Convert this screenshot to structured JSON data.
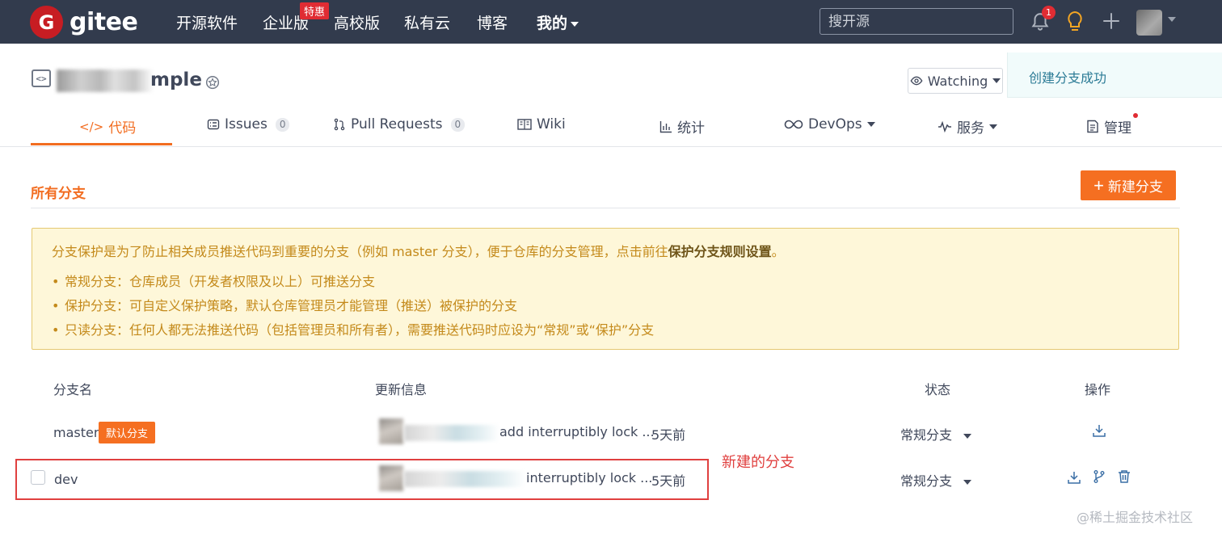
{
  "topnav": {
    "logo_letter": "G",
    "logo_text": "gitee",
    "items": [
      "开源软件",
      "企业版",
      "高校版",
      "私有云",
      "博客",
      "我的"
    ],
    "new_badge": "特惠",
    "search_placeholder": "搜开源",
    "notification_count": "1"
  },
  "repo": {
    "name_visible": "mple",
    "watch_label": "Watching"
  },
  "toast": {
    "message": "创建分支成功"
  },
  "tabs": [
    {
      "label": "代码"
    },
    {
      "label": "Issues",
      "count": "0"
    },
    {
      "label": "Pull Requests",
      "count": "0"
    },
    {
      "label": "Wiki"
    },
    {
      "label": "统计"
    },
    {
      "label": "DevOps"
    },
    {
      "label": "服务"
    },
    {
      "label": "管理"
    }
  ],
  "branches": {
    "title": "所有分支",
    "new_button": "新建分支",
    "notice": {
      "intro_prefix": "分支保护是为了防止相关成员推送代码到重要的分支（例如 master 分支），便于仓库的分支管理，点击前往",
      "intro_link": "保护分支规则设置",
      "intro_suffix": "。",
      "items": [
        "常规分支：仓库成员（开发者权限及以上）可推送分支",
        "保护分支：可自定义保护策略，默认仓库管理员才能管理（推送）被保护的分支",
        "只读分支：任何人都无法推送代码（包括管理员和所有者），需要推送代码时应设为“常规”或“保护”分支"
      ]
    },
    "columns": [
      "分支名",
      "更新信息",
      "状态",
      "操作"
    ],
    "rows": [
      {
        "name": "master",
        "tag": "默认分支",
        "commit": "add interruptibly lock ...",
        "time": "5天前",
        "status": "常规分支"
      },
      {
        "name": "dev",
        "commit": "interruptibly lock ...",
        "time": "5天前",
        "status": "常规分支"
      }
    ]
  },
  "annotation": "新建的分支",
  "watermark": "@稀土掘金技术社区",
  "colors": {
    "nav_bg": "#323b4d",
    "accent": "#f26d21",
    "notice_bg": "#fef7d9",
    "annotation": "#e0403f"
  }
}
